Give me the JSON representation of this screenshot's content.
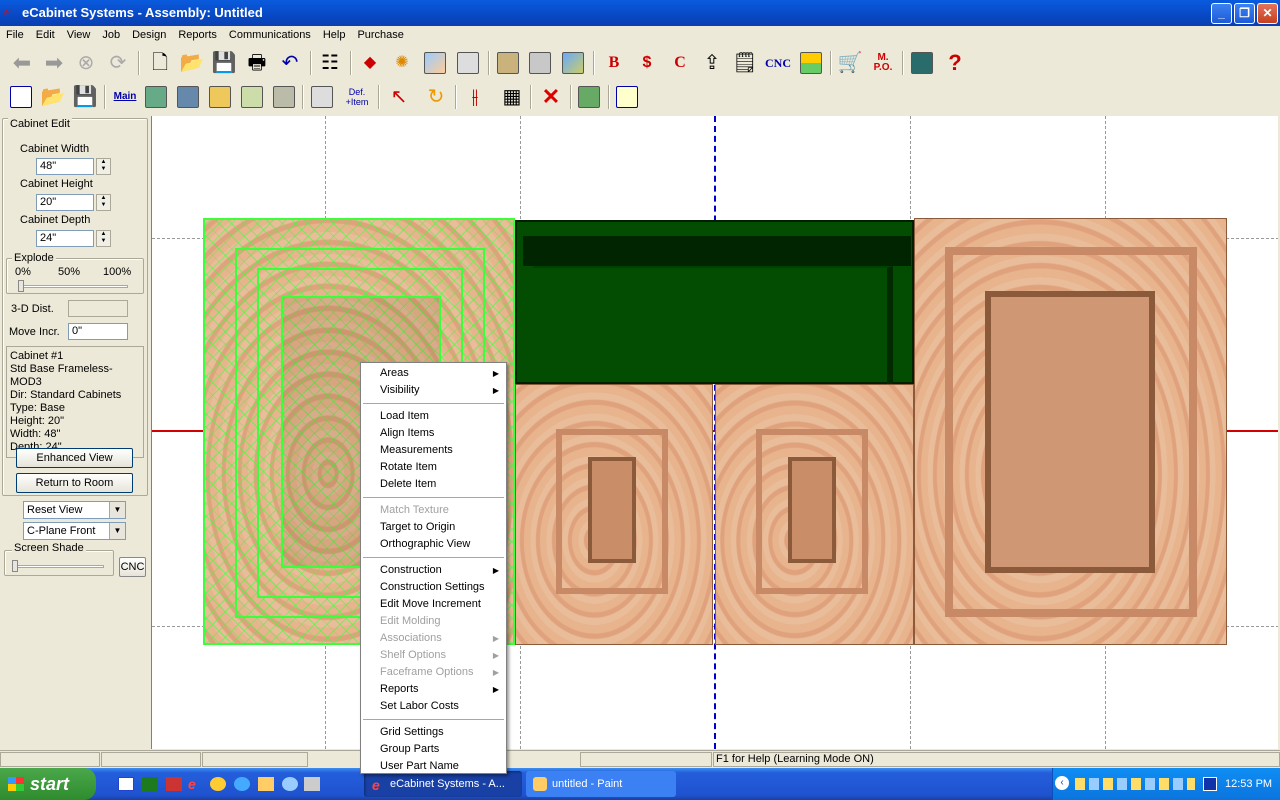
{
  "window": {
    "title": "eCabinet Systems - Assembly: Untitled",
    "controls": {
      "minimize": "_",
      "maximize": "❐",
      "close": "✕"
    }
  },
  "menubar": [
    "File",
    "Edit",
    "View",
    "Job",
    "Design",
    "Reports",
    "Communications",
    "Help",
    "Purchase"
  ],
  "toolbar1": {
    "cnc_label": "CNC",
    "mpo_label": "M.\nP.O.",
    "help_label": "?",
    "b_label": "B",
    "dollar_label": "$",
    "c_label": "C"
  },
  "toolbar2": {
    "main_label": "Main",
    "def_label": "Def.\n+Item"
  },
  "panel": {
    "title": "Cabinet Edit",
    "width_label": "Cabinet Width",
    "width_value": "48\"",
    "height_label": "Cabinet Height",
    "height_value": "20\"",
    "depth_label": "Cabinet Depth",
    "depth_value": "24\"",
    "explode_label": "Explode",
    "explode_ticks": [
      "0%",
      "50%",
      "100%"
    ],
    "dist_label": "3-D Dist.",
    "dist_value": "",
    "incr_label": "Move Incr.",
    "incr_value": "0\"",
    "info_lines": [
      "Cabinet #1",
      "Std Base Frameless-MOD3",
      "Dir: Standard Cabinets",
      "Type: Base",
      "Height: 20\"",
      "Width: 48\"",
      "Depth: 24\""
    ],
    "enhanced_view_btn": "Enhanced View",
    "return_room_btn": "Return to Room",
    "view_select": "Reset View",
    "plane_select": "C-Plane Front",
    "shade_label": "Screen Shade",
    "cnc_btn": "CNC"
  },
  "context_menu": [
    {
      "label": "Areas",
      "submenu": true,
      "disabled": false
    },
    {
      "label": "Visibility",
      "submenu": true,
      "disabled": false
    },
    {
      "sep": true
    },
    {
      "label": "Load Item",
      "submenu": false,
      "disabled": false
    },
    {
      "label": "Align Items",
      "submenu": false,
      "disabled": false
    },
    {
      "label": "Measurements",
      "submenu": false,
      "disabled": false
    },
    {
      "label": "Rotate Item",
      "submenu": false,
      "disabled": false
    },
    {
      "label": "Delete Item",
      "submenu": false,
      "disabled": false
    },
    {
      "sep": true
    },
    {
      "label": "Match Texture",
      "submenu": false,
      "disabled": true
    },
    {
      "label": "Target to Origin",
      "submenu": false,
      "disabled": false
    },
    {
      "label": "Orthographic View",
      "submenu": false,
      "disabled": false
    },
    {
      "sep": true
    },
    {
      "label": "Construction",
      "submenu": true,
      "disabled": false
    },
    {
      "label": "Construction Settings",
      "submenu": false,
      "disabled": false
    },
    {
      "label": "Edit Move Increment",
      "submenu": false,
      "disabled": false
    },
    {
      "label": "Edit Molding",
      "submenu": false,
      "disabled": true
    },
    {
      "label": "Associations",
      "submenu": true,
      "disabled": true
    },
    {
      "label": "Shelf Options",
      "submenu": true,
      "disabled": true
    },
    {
      "label": "Faceframe Options",
      "submenu": true,
      "disabled": true
    },
    {
      "label": "Reports",
      "submenu": true,
      "disabled": false
    },
    {
      "label": "Set Labor Costs",
      "submenu": false,
      "disabled": false
    },
    {
      "sep": true
    },
    {
      "label": "Grid Settings",
      "submenu": false,
      "disabled": false
    },
    {
      "label": "Group Parts",
      "submenu": false,
      "disabled": false
    },
    {
      "label": "User Part Name",
      "submenu": false,
      "disabled": false
    }
  ],
  "statusbar": {
    "help_text": "F1 for Help (Learning Mode ON)"
  },
  "taskbar": {
    "start_label": "start",
    "tasks": [
      "eCabinet Systems - A...",
      "untitled - Paint"
    ],
    "clock": "12:53 PM"
  },
  "colors": {
    "cabinet_green": "#024d02",
    "selection_green": "#3cff3c",
    "axis_red": "#d40000",
    "axis_blue": "#0000c8"
  }
}
